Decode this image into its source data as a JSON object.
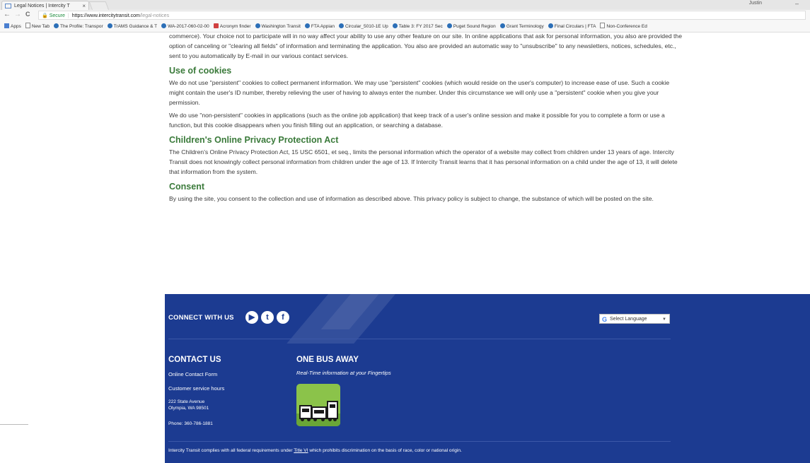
{
  "browser": {
    "tab_title": "Legal Notices | Intercity T",
    "tab_close": "×",
    "profile_name": "Justin",
    "window_minimize": "–",
    "nav": {
      "back": "←",
      "forward": "→",
      "reload": "C"
    },
    "secure_label": "Secure",
    "url_host": "https://www.intercitytransit.com",
    "url_path": "/legal-notices",
    "bookmarks": [
      {
        "label": "Apps",
        "icon": "grid"
      },
      {
        "label": "New Tab",
        "icon": "doc"
      },
      {
        "label": "The Profile: Transpor",
        "icon": "circle"
      },
      {
        "label": "TrAMS Guidance & T",
        "icon": "circle"
      },
      {
        "label": "WA-2017-060-02-00",
        "icon": "circle"
      },
      {
        "label": "Acronym finder",
        "icon": "sq"
      },
      {
        "label": "Washington Transit",
        "icon": "circle"
      },
      {
        "label": "FTA Appian",
        "icon": "circle"
      },
      {
        "label": "Circular_5010-1E Up",
        "icon": "circle"
      },
      {
        "label": "Table 3: FY 2017 Sec",
        "icon": "circle"
      },
      {
        "label": "Puget Sound Region",
        "icon": "circle"
      },
      {
        "label": "Grant Terminology",
        "icon": "circle"
      },
      {
        "label": "Final Circulars | FTA",
        "icon": "circle"
      },
      {
        "label": "Non-Conference Ed",
        "icon": "doc"
      }
    ]
  },
  "content": {
    "intro_paragraph": "commerce). Your choice not to participate will in no way affect your ability to use any other feature on our site. In online applications that ask for personal information, you also are provided the option of canceling or \"clearing all fields\" of information and terminating the application. You also are provided an automatic way to \"unsubscribe\" to any newsletters, notices, schedules, etc., sent to you automatically by E-mail in our various contact services.",
    "cookies_heading": "Use of cookies",
    "cookies_p1": "We do not use \"persistent\" cookies to collect permanent information. We may use \"persistent\" cookies (which would reside on the user's computer) to increase ease of use. Such a cookie might contain the user's ID number, thereby relieving the user of having to always enter the number. Under this circumstance we will only use a \"persistent\" cookie when you give your permission.",
    "cookies_p2": "We do use \"non-persistent\" cookies in applications (such as the online job application) that keep track of a user's online session and make it possible for you to complete a form or use a function, but this cookie disappears when you finish filling out an application, or searching a database.",
    "coppa_heading": "Children's Online Privacy Protection Act",
    "coppa_p": "The Children's Online Privacy Protection Act, 15 USC 6501, et seq., limits the personal information which the operator of a website may collect from children under 13 years of age. Intercity Transit does not knowingly collect personal information from children under the age of 13. If Intercity Transit learns that it has personal information on a child under the age of 13, it will delete that information from the system.",
    "consent_heading": "Consent",
    "consent_p": "By using the site, you consent to the collection and use of information as described above. This privacy policy is subject to change, the substance of which will be posted on the site."
  },
  "footer": {
    "connect_label": "CONNECT WITH US",
    "social": [
      {
        "name": "youtube",
        "glyph": "▶"
      },
      {
        "name": "twitter",
        "glyph": "t"
      },
      {
        "name": "facebook",
        "glyph": "f"
      }
    ],
    "language_label": "Select Language",
    "language_g": "G",
    "language_arrow": "▼",
    "contact_heading": "CONTACT US",
    "contact_form": "Online Contact Form",
    "service_hours": "Customer service hours",
    "address_line1": "222 State Avenue",
    "address_line2": "Olympia, WA 98501",
    "phone": "Phone: 360-786-1881",
    "onebus_heading": "ONE BUS AWAY",
    "onebus_tagline": "Real-Time information at your Fingertips",
    "compliance_pre": "Intercity Transit complies with all federal requirements under ",
    "compliance_link": "Title VI",
    "compliance_post": " which prohibits discrimination on the basis of race, color or national origin."
  },
  "colors": {
    "heading_green": "#3a7a3a",
    "footer_blue": "#1c3b91",
    "secure_green": "#1a8a3a"
  }
}
